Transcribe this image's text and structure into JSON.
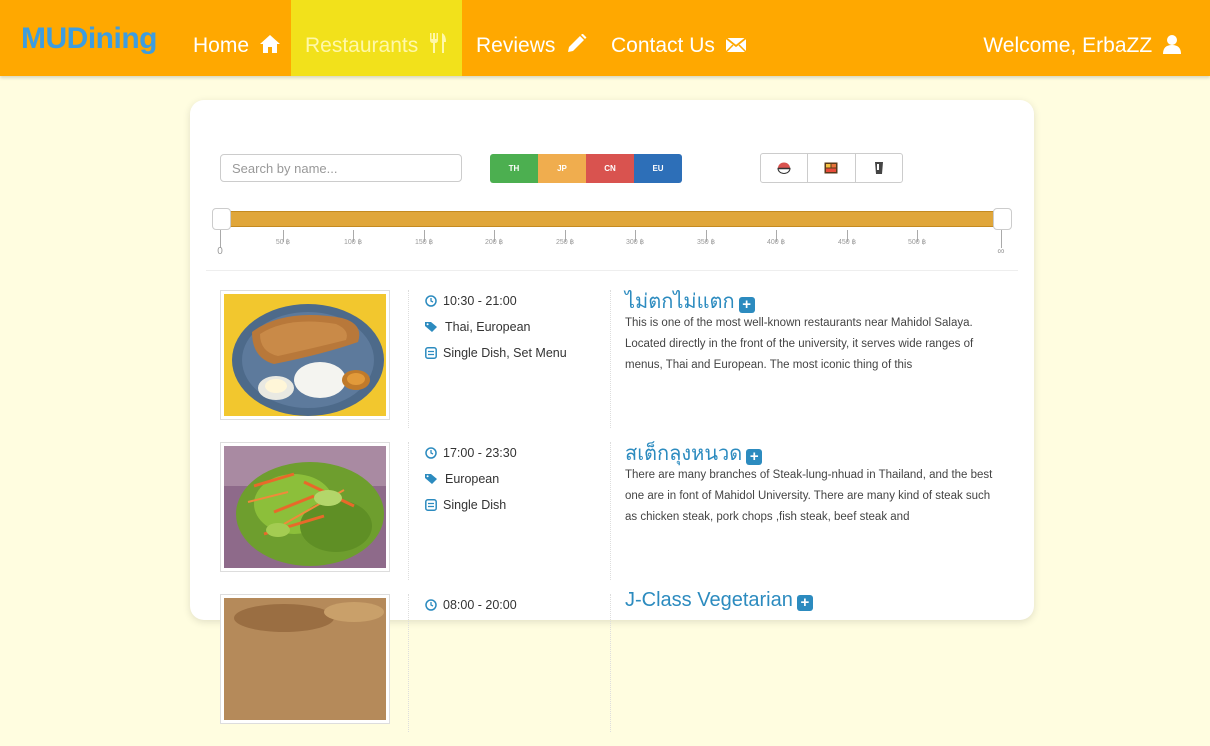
{
  "brand": "MUDining",
  "nav": {
    "home": "Home",
    "restaurants": "Restaurants",
    "reviews": "Reviews",
    "contact": "Contact Us",
    "welcome": "Welcome, ErbaZZ"
  },
  "search": {
    "placeholder": "Search by name..."
  },
  "cuisine_filters": [
    {
      "label": "TH",
      "color": "#4caf50"
    },
    {
      "label": "JP",
      "color": "#f0ad4e"
    },
    {
      "label": "CN",
      "color": "#d9534f"
    },
    {
      "label": "EU",
      "color": "#2d6fb8"
    }
  ],
  "type_filters": [
    "bowl-icon",
    "bento-icon",
    "drink-icon"
  ],
  "price_slider": {
    "min_label": "0",
    "max_label": "∞",
    "min_value": 0,
    "max_value": "∞",
    "ticks": [
      "50 ฿",
      "100 ฿",
      "150 ฿",
      "200 ฿",
      "250 ฿",
      "300 ฿",
      "350 ฿",
      "400 ฿",
      "450 ฿",
      "500 ฿"
    ]
  },
  "restaurants": [
    {
      "name": "ไม่ตกไม่แตก",
      "hours": "10:30 - 21:00",
      "cuisine": "Thai, European",
      "menu": "Single Dish, Set Menu",
      "description": "This is one of the most well-known restaurants near Mahidol Salaya. Located directly in the front of the university, it serves wide ranges of menus, Thai and European. The most iconic thing of this"
    },
    {
      "name": "สเต็กลุงหนวด",
      "hours": "17:00 - 23:30",
      "cuisine": "European",
      "menu": "Single Dish",
      "description": "There are many branches of Steak-lung-nhuad in Thailand, and the best one are in font of Mahidol University. There are many kind of steak such as chicken steak, pork chops ,fish steak, beef steak and"
    },
    {
      "name": "J-Class Vegetarian",
      "hours": "08:00 - 20:00",
      "cuisine": "",
      "menu": "",
      "description": ""
    }
  ]
}
